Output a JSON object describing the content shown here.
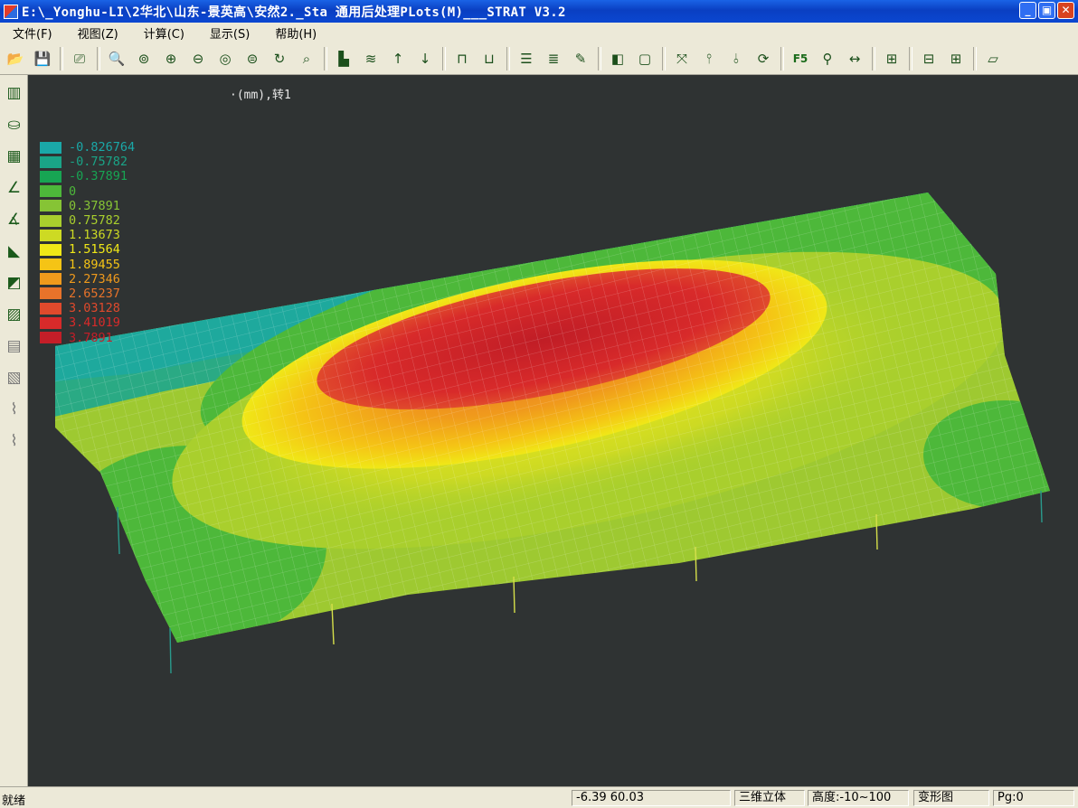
{
  "window": {
    "title": "E:\\_Yonghu-LI\\2华北\\山东-景英高\\安然2._Sta  通用后处理PLots(M)___STRAT V3.2",
    "minimize": "_",
    "maximize": "▣",
    "close": "✕"
  },
  "menu": [
    {
      "label": "文件(F)"
    },
    {
      "label": "视图(Z)"
    },
    {
      "label": "计算(C)"
    },
    {
      "label": "显示(S)"
    },
    {
      "label": "帮助(H)"
    }
  ],
  "toolbar": [
    {
      "icon": "open-folder-icon",
      "glyph": "📂"
    },
    {
      "icon": "save-icon",
      "glyph": "💾"
    },
    {
      "sep": true
    },
    {
      "icon": "print-preview-icon",
      "glyph": "⎚"
    },
    {
      "sep": true
    },
    {
      "icon": "zoom-window-icon",
      "glyph": "🔍"
    },
    {
      "icon": "zoom-all-icon",
      "glyph": "⊚"
    },
    {
      "icon": "zoom-in-icon",
      "glyph": "⊕"
    },
    {
      "icon": "zoom-out-icon",
      "glyph": "⊖"
    },
    {
      "icon": "zoom-previous-icon",
      "glyph": "◎"
    },
    {
      "icon": "zoom-dynamic-icon",
      "glyph": "⊜"
    },
    {
      "icon": "rotate-icon",
      "glyph": "↻"
    },
    {
      "icon": "zoom-realtime-icon",
      "glyph": "⌕"
    },
    {
      "sep": true
    },
    {
      "icon": "building-view-icon",
      "glyph": "▙"
    },
    {
      "icon": "layers-icon",
      "glyph": "≋"
    },
    {
      "icon": "arrow-up-icon",
      "glyph": "↑"
    },
    {
      "icon": "arrow-down-icon",
      "glyph": "↓"
    },
    {
      "sep": true
    },
    {
      "icon": "column-icon",
      "glyph": "⊓"
    },
    {
      "icon": "wall-icon",
      "glyph": "⊔"
    },
    {
      "sep": true
    },
    {
      "icon": "floor-stack-icon",
      "glyph": "☰"
    },
    {
      "icon": "floor-layers-icon",
      "glyph": "≣"
    },
    {
      "icon": "floor-edit-icon",
      "glyph": "✎"
    },
    {
      "sep": true
    },
    {
      "icon": "box-solid-icon",
      "glyph": "◧"
    },
    {
      "icon": "box-wire-icon",
      "glyph": "▢"
    },
    {
      "sep": true
    },
    {
      "icon": "axis-icon",
      "glyph": "⤧"
    },
    {
      "icon": "support-icon",
      "glyph": "⫯"
    },
    {
      "icon": "support-spring-icon",
      "glyph": "⫰"
    },
    {
      "icon": "refresh-icon",
      "glyph": "⟳"
    },
    {
      "sep": true
    },
    {
      "icon": "f5-icon",
      "text": "F5"
    },
    {
      "icon": "magnify-icon",
      "glyph": "⚲"
    },
    {
      "icon": "dimension-icon",
      "glyph": "↔"
    },
    {
      "sep": true
    },
    {
      "icon": "grid-ruler-icon",
      "glyph": "⊞"
    },
    {
      "sep": true
    },
    {
      "icon": "table-red-icon",
      "glyph": "⊟"
    },
    {
      "icon": "table-icon",
      "glyph": "⊞"
    },
    {
      "sep": true
    },
    {
      "icon": "slab-icon",
      "glyph": "▱"
    }
  ],
  "sidebar": [
    {
      "icon": "building-icon",
      "glyph": "▥"
    },
    {
      "icon": "cylinder-icon",
      "glyph": "⛀"
    },
    {
      "icon": "grid-frame-icon",
      "glyph": "▦"
    },
    {
      "icon": "angle-icon",
      "glyph": "∠"
    },
    {
      "icon": "angle-multi-icon",
      "glyph": "∡"
    },
    {
      "icon": "triangle-icon",
      "glyph": "◣"
    },
    {
      "icon": "triangle-split-icon",
      "glyph": "◩"
    },
    {
      "icon": "slab-grid-icon",
      "glyph": "▨"
    },
    {
      "icon": "table-grid-icon",
      "glyph": "▤",
      "grey": true
    },
    {
      "icon": "slab-outline-icon",
      "glyph": "▧",
      "grey": true
    },
    {
      "icon": "spring-icon",
      "glyph": "⌇",
      "grey": true
    },
    {
      "icon": "spring-double-icon",
      "glyph": "⌇",
      "grey": true
    }
  ],
  "canvas": {
    "unit_label": "·(mm),转1"
  },
  "legend": [
    {
      "value": "-0.826764",
      "color": "#1aa8a8"
    },
    {
      "value": "-0.75782",
      "color": "#1aa487"
    },
    {
      "value": "-0.37891",
      "color": "#17a553"
    },
    {
      "value": "0",
      "color": "#4db83a"
    },
    {
      "value": "0.37891",
      "color": "#86c435"
    },
    {
      "value": "0.75782",
      "color": "#a9cf2d"
    },
    {
      "value": "1.13673",
      "color": "#cdda23"
    },
    {
      "value": "1.51564",
      "color": "#f0e817"
    },
    {
      "value": "1.89455",
      "color": "#f5c415"
    },
    {
      "value": "2.27346",
      "color": "#f09a1c"
    },
    {
      "value": "2.65237",
      "color": "#e8732a"
    },
    {
      "value": "3.03128",
      "color": "#e04a2c"
    },
    {
      "value": "3.41019",
      "color": "#d82a2a"
    },
    {
      "value": "3.7891",
      "color": "#c41e28"
    }
  ],
  "status": {
    "ready": "就绪",
    "coords": "-6.39    60.03",
    "view_mode": "三维立体",
    "height": "高度:-10~100",
    "display": "变形图",
    "page": "Pg:0"
  }
}
